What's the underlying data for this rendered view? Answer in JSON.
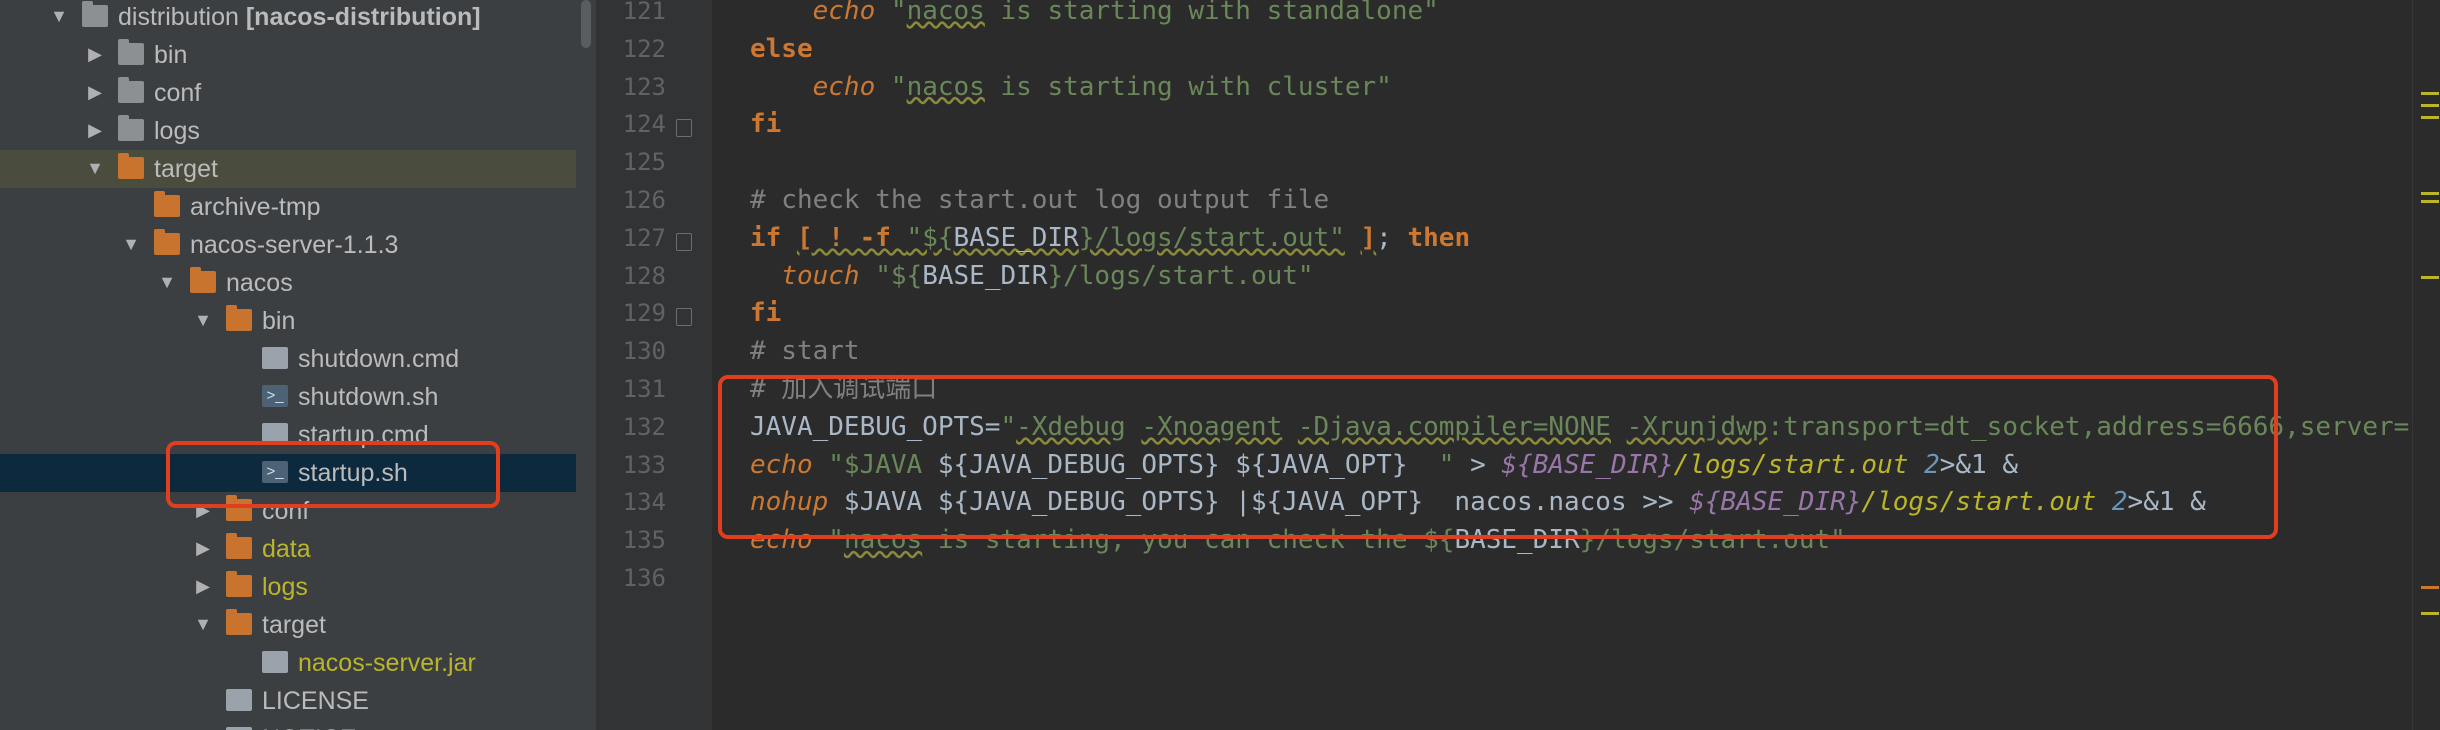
{
  "tree": {
    "items": [
      {
        "label": "distribution [nacos-distribution]",
        "icon": "module-folder-icon",
        "arrow": "down",
        "indent": 0,
        "style": "bold"
      },
      {
        "label": "bin",
        "icon": "folder-icon",
        "arrow": "right",
        "indent": 1
      },
      {
        "label": "conf",
        "icon": "folder-icon",
        "arrow": "right",
        "indent": 1
      },
      {
        "label": "logs",
        "icon": "folder-icon",
        "arrow": "right",
        "indent": 1
      },
      {
        "label": "target",
        "icon": "folder-icon",
        "arrow": "down",
        "indent": 1
      },
      {
        "label": "archive-tmp",
        "icon": "folder-icon",
        "arrow": "none",
        "indent": 2
      },
      {
        "label": "nacos-server-1.1.3",
        "icon": "folder-icon",
        "arrow": "down",
        "indent": 2
      },
      {
        "label": "nacos",
        "icon": "folder-icon",
        "arrow": "down",
        "indent": 3
      },
      {
        "label": "bin",
        "icon": "folder-icon",
        "arrow": "down",
        "indent": 4
      },
      {
        "label": "shutdown.cmd",
        "icon": "file-icon",
        "arrow": "none",
        "indent": 5
      },
      {
        "label": "shutdown.sh",
        "icon": "shell-script-icon",
        "arrow": "none",
        "indent": 5
      },
      {
        "label": "startup.cmd",
        "icon": "file-icon",
        "arrow": "none",
        "indent": 5
      },
      {
        "label": "startup.sh",
        "icon": "shell-script-icon",
        "arrow": "none",
        "indent": 5,
        "selected": true
      },
      {
        "label": "conf",
        "icon": "folder-icon",
        "arrow": "right",
        "indent": 4
      },
      {
        "label": "data",
        "icon": "folder-icon",
        "arrow": "right",
        "indent": 4,
        "style": "yellow"
      },
      {
        "label": "logs",
        "icon": "folder-icon",
        "arrow": "right",
        "indent": 4,
        "style": "yellow"
      },
      {
        "label": "target",
        "icon": "folder-icon",
        "arrow": "down",
        "indent": 4
      },
      {
        "label": "nacos-server.jar",
        "icon": "jar-icon",
        "arrow": "none",
        "indent": 5,
        "style": "yellow"
      },
      {
        "label": "LICENSE",
        "icon": "file-icon",
        "arrow": "none",
        "indent": 4
      },
      {
        "label": "NOTICE",
        "icon": "file-icon",
        "arrow": "none",
        "indent": 4
      }
    ]
  },
  "editor": {
    "line_numbers": [
      "121",
      "122",
      "123",
      "124",
      "125",
      "126",
      "127",
      "128",
      "129",
      "130",
      "131",
      "132",
      "133",
      "134",
      "135",
      "136"
    ],
    "lines": [
      [
        {
          "t": "    "
        },
        {
          "t": "echo",
          "c": "cmd"
        },
        {
          "t": " "
        },
        {
          "t": "\"",
          "c": "str"
        },
        {
          "t": "nacos",
          "c": "str sq"
        },
        {
          "t": " is starting with standalone\"",
          "c": "str"
        }
      ],
      [
        {
          "t": "else",
          "c": "kw"
        }
      ],
      [
        {
          "t": "    "
        },
        {
          "t": "echo",
          "c": "cmd"
        },
        {
          "t": " "
        },
        {
          "t": "\"",
          "c": "str"
        },
        {
          "t": "nacos",
          "c": "str sq"
        },
        {
          "t": " is starting with cluster\"",
          "c": "str"
        }
      ],
      [
        {
          "t": "fi",
          "c": "kw"
        }
      ],
      [
        {
          "t": ""
        }
      ],
      [
        {
          "t": "# check the start.out log output file",
          "c": "cmt"
        }
      ],
      [
        {
          "t": "if",
          "c": "kw"
        },
        {
          "t": " "
        },
        {
          "t": "[ ! -f ",
          "c": "kw sq"
        },
        {
          "t": "\"${",
          "c": "str sq"
        },
        {
          "t": "BASE_DIR",
          "c": "var sq"
        },
        {
          "t": "}/logs/start.out\"",
          "c": "str sq"
        },
        {
          "t": " "
        },
        {
          "t": "]",
          "c": "kw sq"
        },
        {
          "t": "; "
        },
        {
          "t": "then",
          "c": "kw"
        }
      ],
      [
        {
          "t": "  "
        },
        {
          "t": "touch",
          "c": "cmd"
        },
        {
          "t": " "
        },
        {
          "t": "\"${",
          "c": "str"
        },
        {
          "t": "BASE_DIR",
          "c": "var"
        },
        {
          "t": "}/logs/start.out\"",
          "c": "str"
        }
      ],
      [
        {
          "t": "fi",
          "c": "kw"
        }
      ],
      [
        {
          "t": "# start",
          "c": "cmt"
        }
      ],
      [
        {
          "t": "# 加入调试端口",
          "c": "cmt"
        }
      ],
      [
        {
          "t": "JAVA_DEBUG_OPTS="
        },
        {
          "t": "\"",
          "c": "str"
        },
        {
          "t": "-Xdebug",
          "c": "str sq"
        },
        {
          "t": " ",
          "c": "str"
        },
        {
          "t": "-Xnoagent",
          "c": "str sq"
        },
        {
          "t": " ",
          "c": "str"
        },
        {
          "t": "-Djava.compiler=NONE",
          "c": "str sq"
        },
        {
          "t": " ",
          "c": "str"
        },
        {
          "t": "-Xrunjdwp",
          "c": "str sq"
        },
        {
          "t": ":transport=dt_socket,address=6666,server=",
          "c": "str"
        }
      ],
      [
        {
          "t": "echo",
          "c": "cmd"
        },
        {
          "t": " "
        },
        {
          "t": "\"$JAVA ",
          "c": "str"
        },
        {
          "t": "${JAVA_DEBUG_OPTS}",
          "c": "var"
        },
        {
          "t": " ",
          "c": "str"
        },
        {
          "t": "${JAVA_OPT}",
          "c": "var"
        },
        {
          "t": "  \"",
          "c": "str"
        },
        {
          "t": " > "
        },
        {
          "t": "${BASE_DIR}",
          "c": "ivar"
        },
        {
          "t": "/logs/start.out",
          "c": "cmd2"
        },
        {
          "t": " "
        },
        {
          "t": "2",
          "c": "num"
        },
        {
          "t": ">&1 &"
        }
      ],
      [
        {
          "t": "nohup",
          "c": "cmd"
        },
        {
          "t": " $JAVA "
        },
        {
          "t": "${JAVA_DEBUG_OPTS}",
          "c": "var"
        },
        {
          "t": " |"
        },
        {
          "t": "${JAVA_OPT}",
          "c": "var"
        },
        {
          "t": "  nacos.nacos >> "
        },
        {
          "t": "${BASE_DIR}",
          "c": "ivar"
        },
        {
          "t": "/logs/start.out",
          "c": "cmd2"
        },
        {
          "t": " "
        },
        {
          "t": "2",
          "c": "num"
        },
        {
          "t": ">&1 &"
        }
      ],
      [
        {
          "t": "echo",
          "c": "cmd"
        },
        {
          "t": " "
        },
        {
          "t": "\"",
          "c": "str"
        },
        {
          "t": "nacos",
          "c": "str sq"
        },
        {
          "t": " is starting, you can check the ",
          "c": "str"
        },
        {
          "t": "${",
          "c": "str"
        },
        {
          "t": "BASE_DIR",
          "c": "var"
        },
        {
          "t": "}/logs/start.out\"",
          "c": "str"
        }
      ],
      [
        {
          "t": ""
        }
      ]
    ]
  },
  "annotation_color": "#e03e1e"
}
